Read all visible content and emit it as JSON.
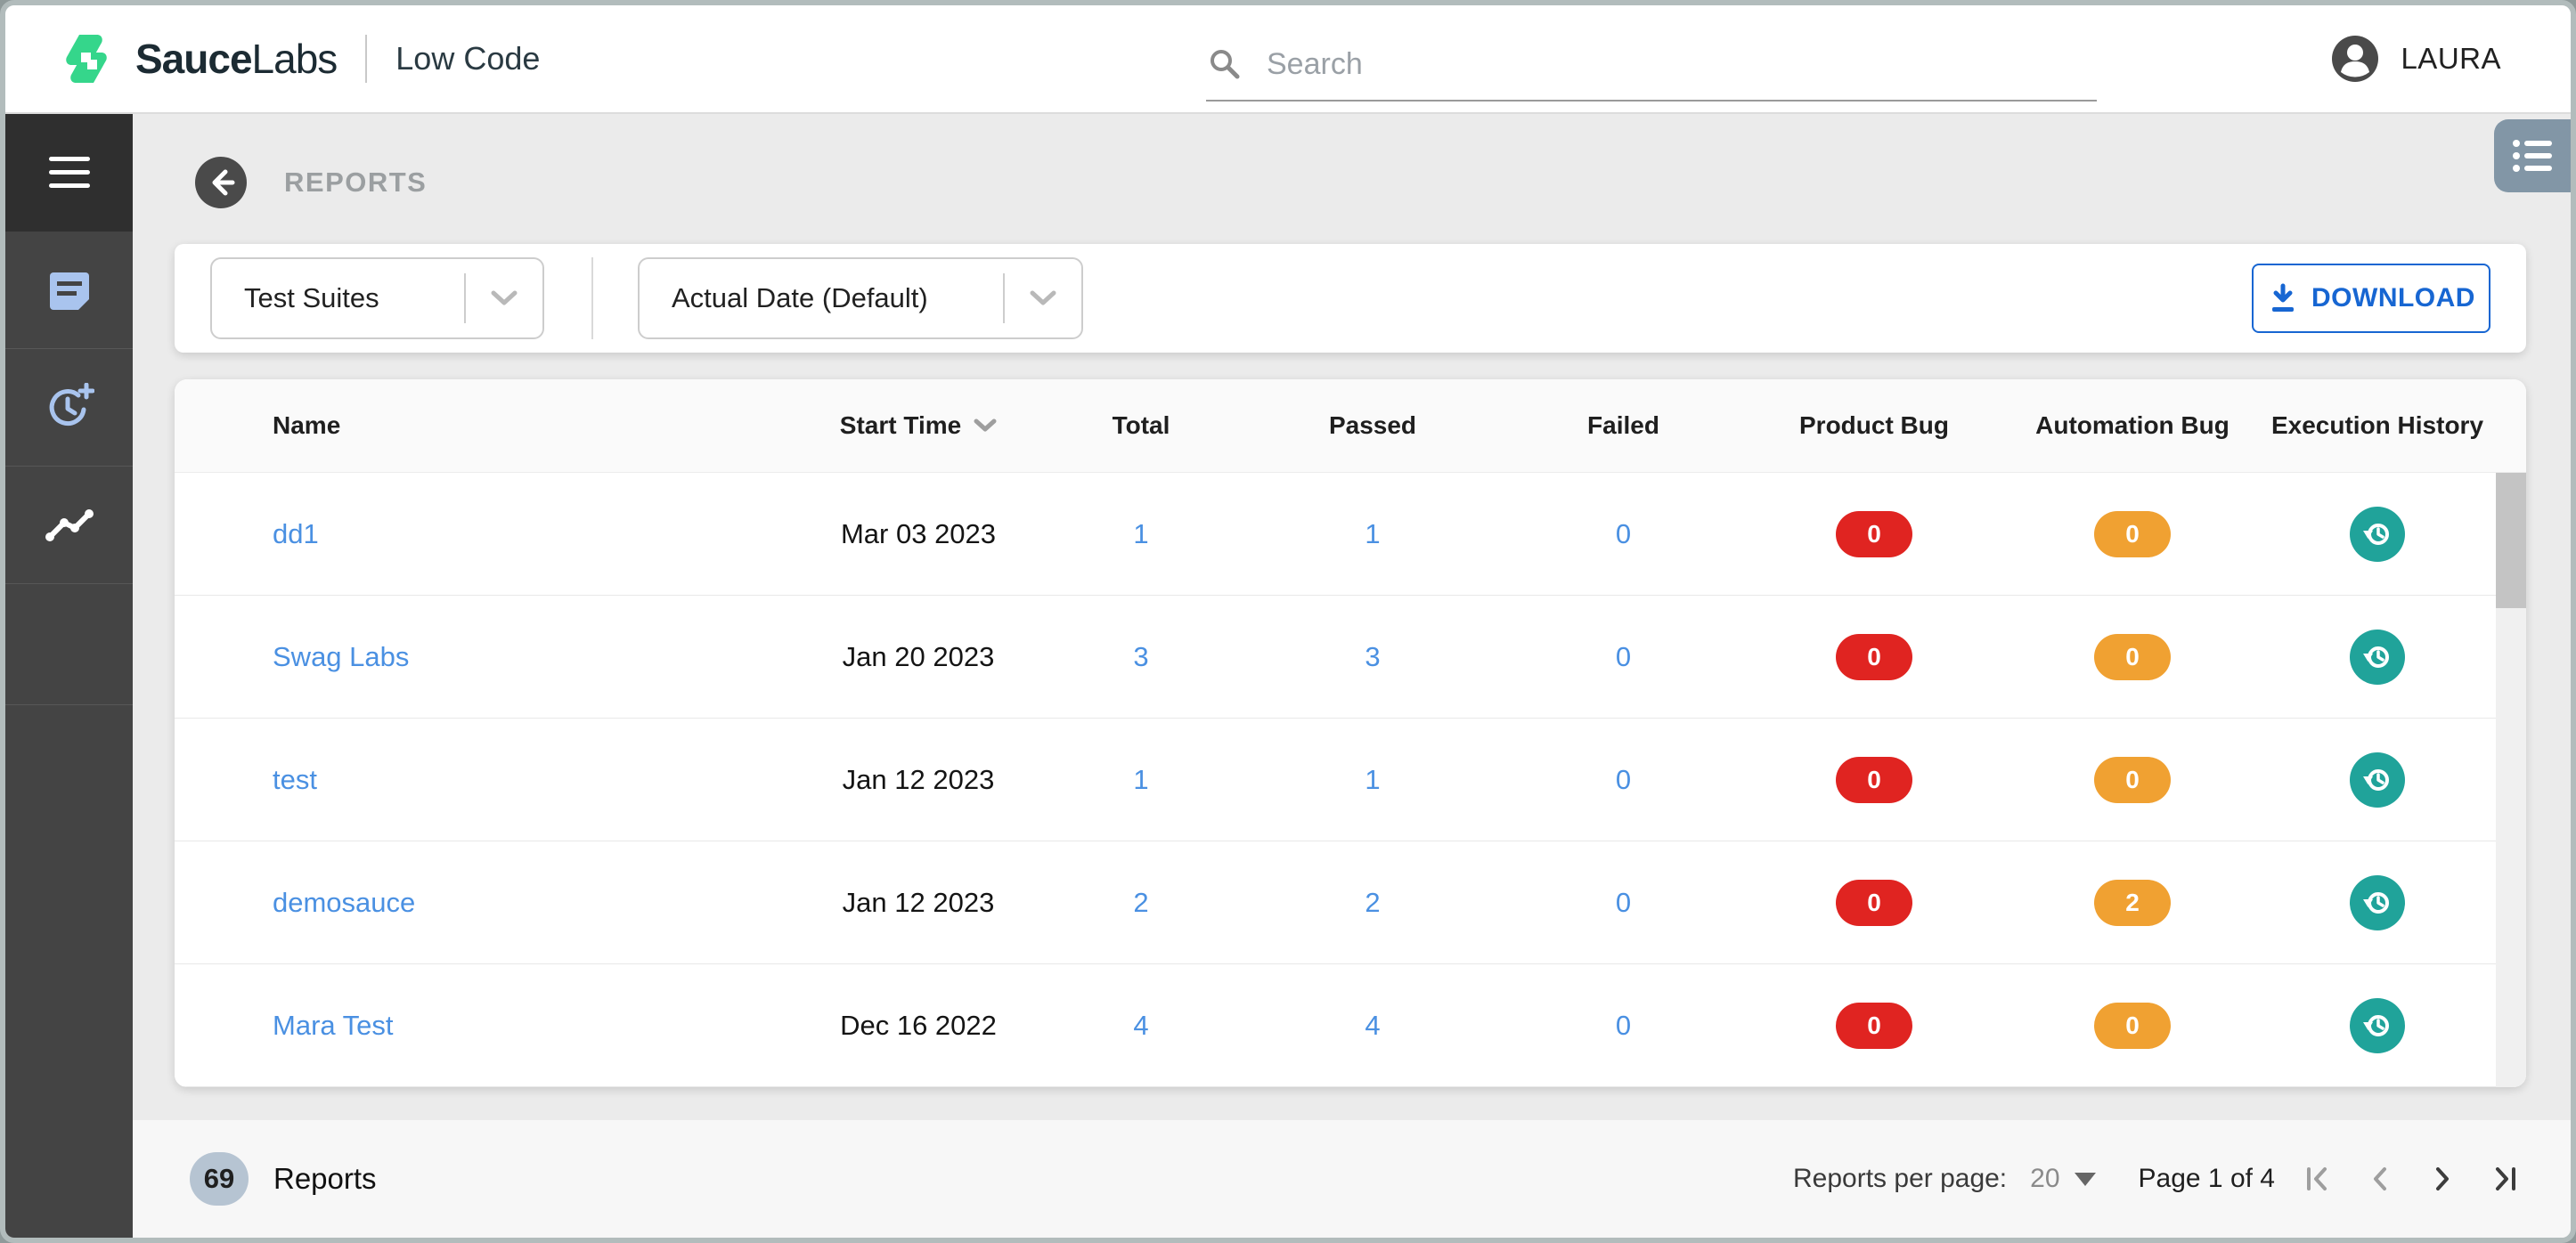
{
  "header": {
    "brand": {
      "name_bold": "Sauce",
      "name_regular": "Labs",
      "product": "Low Code"
    },
    "search": {
      "placeholder": "Search"
    },
    "user": {
      "name": "LAURA"
    }
  },
  "sidebar": {
    "items": [
      {
        "icon": "hamburger-menu-icon"
      },
      {
        "icon": "document-icon"
      },
      {
        "icon": "clock-plus-icon"
      },
      {
        "icon": "trend-line-icon",
        "active": true
      }
    ]
  },
  "page": {
    "title": "REPORTS"
  },
  "filters": {
    "suite_filter_value": "Test Suites",
    "date_filter_value": "Actual Date (Default)",
    "download_label": "DOWNLOAD"
  },
  "table": {
    "columns": {
      "name": "Name",
      "start_time": "Start Time",
      "total": "Total",
      "passed": "Passed",
      "failed": "Failed",
      "product_bug": "Product Bug",
      "automation_bug": "Automation Bug",
      "execution_history": "Execution History"
    },
    "rows": [
      {
        "name": "dd1",
        "start_time": "Mar 03 2023",
        "total": "1",
        "passed": "1",
        "failed": "0",
        "product_bug": "0",
        "automation_bug": "0"
      },
      {
        "name": "Swag Labs",
        "start_time": "Jan 20 2023",
        "total": "3",
        "passed": "3",
        "failed": "0",
        "product_bug": "0",
        "automation_bug": "0"
      },
      {
        "name": "test",
        "start_time": "Jan 12 2023",
        "total": "1",
        "passed": "1",
        "failed": "0",
        "product_bug": "0",
        "automation_bug": "0"
      },
      {
        "name": "demosauce",
        "start_time": "Jan 12 2023",
        "total": "2",
        "passed": "2",
        "failed": "0",
        "product_bug": "0",
        "automation_bug": "2"
      },
      {
        "name": "Mara Test",
        "start_time": "Dec 16 2022",
        "total": "4",
        "passed": "4",
        "failed": "0",
        "product_bug": "0",
        "automation_bug": "0"
      }
    ]
  },
  "footer": {
    "count": "69",
    "count_label": "Reports",
    "per_page_label": "Reports per page:",
    "per_page_value": "20",
    "page_info": "Page 1 of 4"
  },
  "colors": {
    "accent_blue": "#1766d2",
    "link_blue": "#4a90e2",
    "badge_red": "#e02421",
    "badge_orange": "#f0a132",
    "history_teal": "#20a39a",
    "sidebar_icon_blue": "#a9c4ee",
    "brand_green": "#35d68b",
    "count_pill": "#b6c4d2",
    "list_button": "#8296a6"
  }
}
